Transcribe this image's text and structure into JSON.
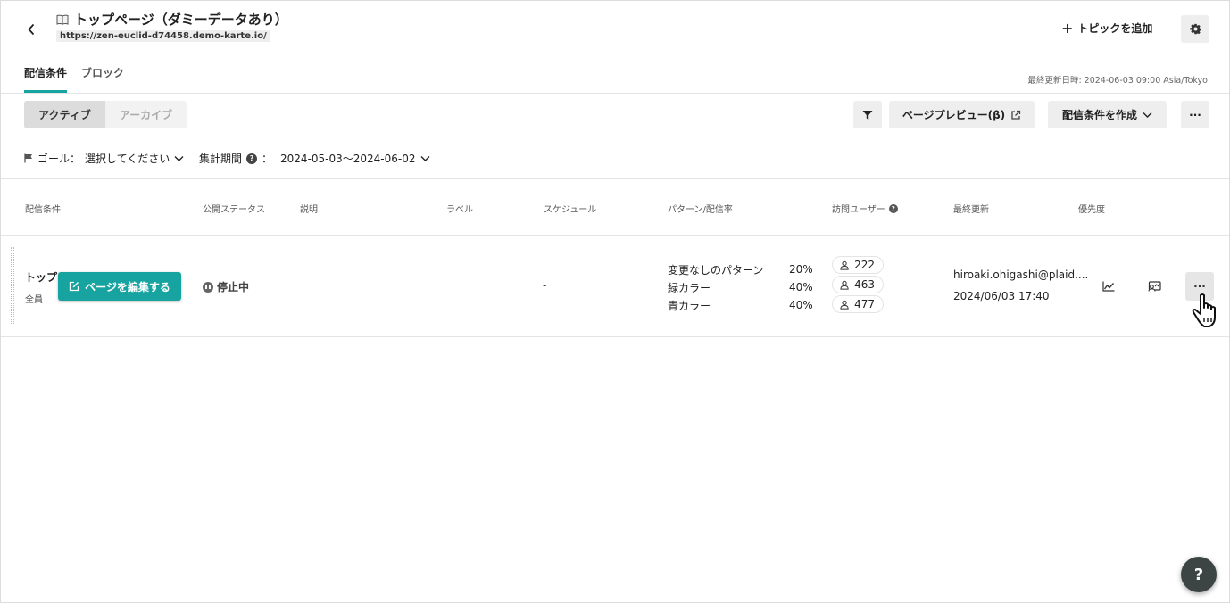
{
  "header": {
    "title": "トップページ（ダミーデータあり）",
    "url": "https://zen-euclid-d74458.demo-karte.io/",
    "add_topic_label": "トピックを追加",
    "tabs": [
      {
        "label": "配信条件",
        "active": true
      },
      {
        "label": "ブロック",
        "active": false
      }
    ],
    "last_updated": "最終更新日時: 2024-06-03 09:00 Asia/Tokyo"
  },
  "toolbar": {
    "segment": [
      {
        "label": "アクティブ",
        "selected": true
      },
      {
        "label": "アーカイブ",
        "selected": false
      }
    ],
    "page_preview_label": "ページプレビュー(β)",
    "create_condition_label": "配信条件を作成",
    "more_label": "···"
  },
  "filters": {
    "goal_label": "ゴール：",
    "goal_value": "選択してください",
    "period_label": "集計期間",
    "period_colon": "：",
    "period_value": "2024-05-03〜2024-06-02"
  },
  "table": {
    "headers": [
      "配信条件",
      "公開ステータス",
      "説明",
      "ラベル",
      "スケジュール",
      "パターン/配信率",
      "訪問ユーザー",
      "最終更新",
      "優先度"
    ],
    "rows": [
      {
        "name": "トップ",
        "target": "全員",
        "edit_label": "ページを編集する",
        "status": "停止中",
        "schedule": "-",
        "patterns": [
          {
            "name": "変更なしのパターン",
            "rate": "20%",
            "visitors": "222"
          },
          {
            "name": "緑カラー",
            "rate": "40%",
            "visitors": "463"
          },
          {
            "name": "青カラー",
            "rate": "40%",
            "visitors": "477"
          }
        ],
        "updated_by": "hiroaki.ohigashi@plaid....",
        "updated_at": "2024/06/03 17:40",
        "more_label": "···"
      }
    ]
  },
  "help_label": "?",
  "colors": {
    "accent": "#17a3a0",
    "fab": "#3c4444"
  }
}
